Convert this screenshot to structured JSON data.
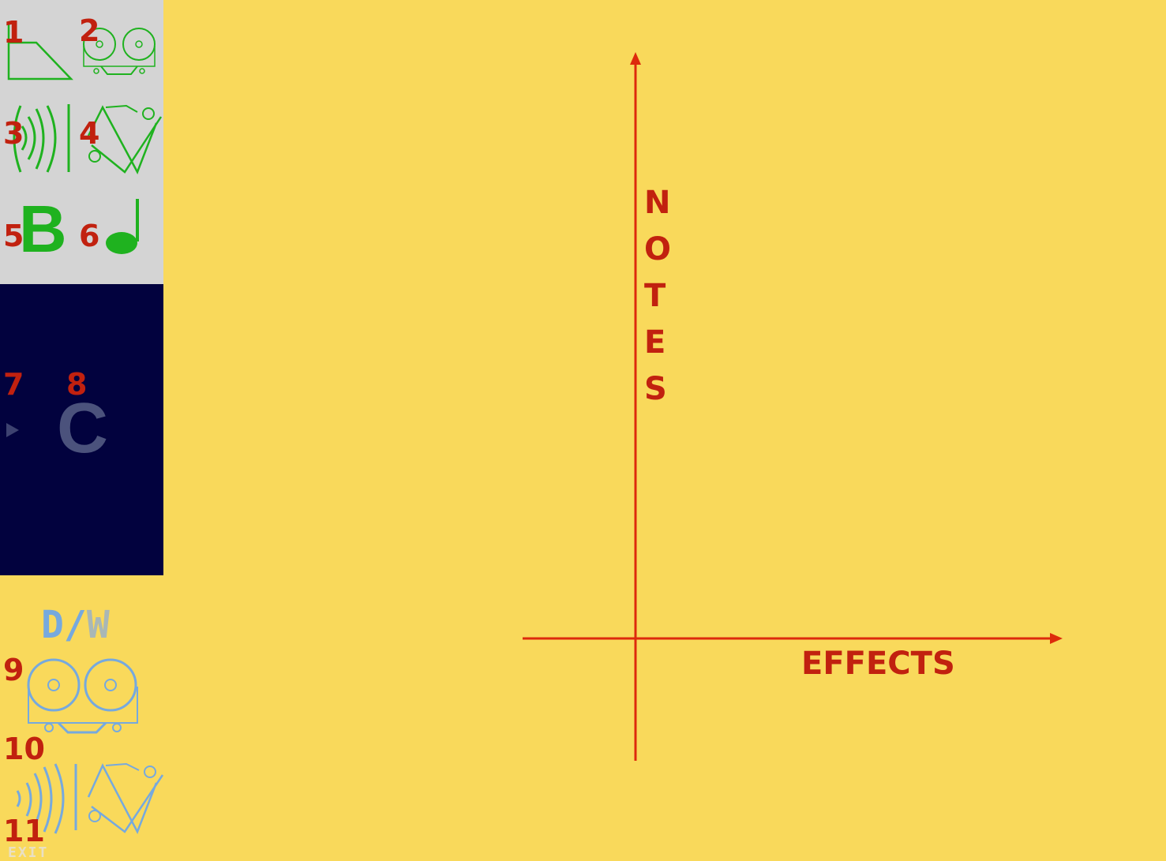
{
  "tools": {
    "numbers": [
      "1",
      "2",
      "3",
      "4",
      "5",
      "6",
      "7",
      "8",
      "9",
      "10",
      "11"
    ],
    "b_letter": "B",
    "c_letter": "C",
    "dw": {
      "d": "D",
      "slash": "/",
      "w": "W"
    },
    "exit_label": "EXIT"
  },
  "icons": [
    "envelope-icon",
    "tape-reel-icon",
    "reverb-waves-icon",
    "modulation-icon",
    "note-icon",
    "play-icon",
    "dry-wet-tape-icon",
    "dry-wet-effects-icon"
  ],
  "graph": {
    "y_label_letters": [
      "N",
      "O",
      "T",
      "E",
      "S"
    ],
    "x_label": "EFFECTS"
  },
  "colors": {
    "background": "#f9d95b",
    "sidebar_top": "#d4d4d4",
    "sidebar_mid": "#02023e",
    "accent_red": "#c1210f",
    "green": "#1fb21f",
    "blue": "#76a9de"
  }
}
